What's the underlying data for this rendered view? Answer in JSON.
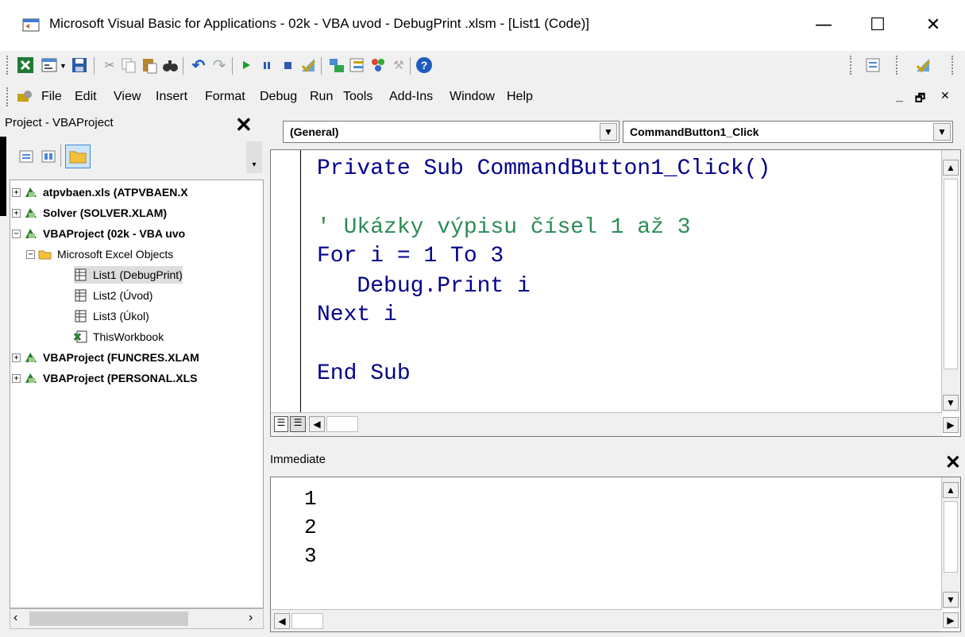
{
  "window": {
    "title": "Microsoft Visual Basic for Applications - 02k - VBA uvod - DebugPrint .xlsm - [List1 (Code)]",
    "minimize": "—",
    "maximize": "☐",
    "close": "✕"
  },
  "menu": {
    "items": [
      "File",
      "Edit",
      "View",
      "Insert",
      "Format",
      "Debug",
      "Run",
      "Tools",
      "Add-Ins",
      "Window",
      "Help"
    ],
    "mdi_controls": [
      "_",
      "🗗",
      "✕"
    ]
  },
  "project": {
    "title": "Project - VBAProject",
    "close": "✕",
    "tree": [
      {
        "label": "atpvbaen.xls (ATPVBAEN.X",
        "expand": "+",
        "bold": true
      },
      {
        "label": "Solver (SOLVER.XLAM)",
        "expand": "+",
        "bold": true
      },
      {
        "label": "VBAProject (02k - VBA uvo",
        "expand": "−",
        "bold": true
      },
      {
        "label": "Microsoft Excel Objects",
        "expand": "−"
      },
      {
        "label": "List1 (DebugPrint)"
      },
      {
        "label": "List2 (Úvod)"
      },
      {
        "label": "List3 (Úkol)"
      },
      {
        "label": "ThisWorkbook"
      },
      {
        "label": "VBAProject (FUNCRES.XLAM",
        "expand": "+",
        "bold": true
      },
      {
        "label": "VBAProject (PERSONAL.XLS",
        "expand": "+",
        "bold": true
      }
    ]
  },
  "code": {
    "object_combo": "(General)",
    "procedure_combo": "CommandButton1_Click",
    "lines": [
      "Private Sub CommandButton1_Click()",
      "",
      "' Ukázky výpisu čísel 1 až 3",
      "For i = 1 To 3",
      "   Debug.Print i",
      "Next i",
      "",
      "End Sub"
    ]
  },
  "immediate": {
    "title": "Immediate",
    "close": "✕",
    "output": [
      "1",
      "2",
      "3"
    ]
  },
  "colors": {
    "keyword": "#00008b",
    "comment": "#2e8b57",
    "accent": "#1c5bbf"
  }
}
